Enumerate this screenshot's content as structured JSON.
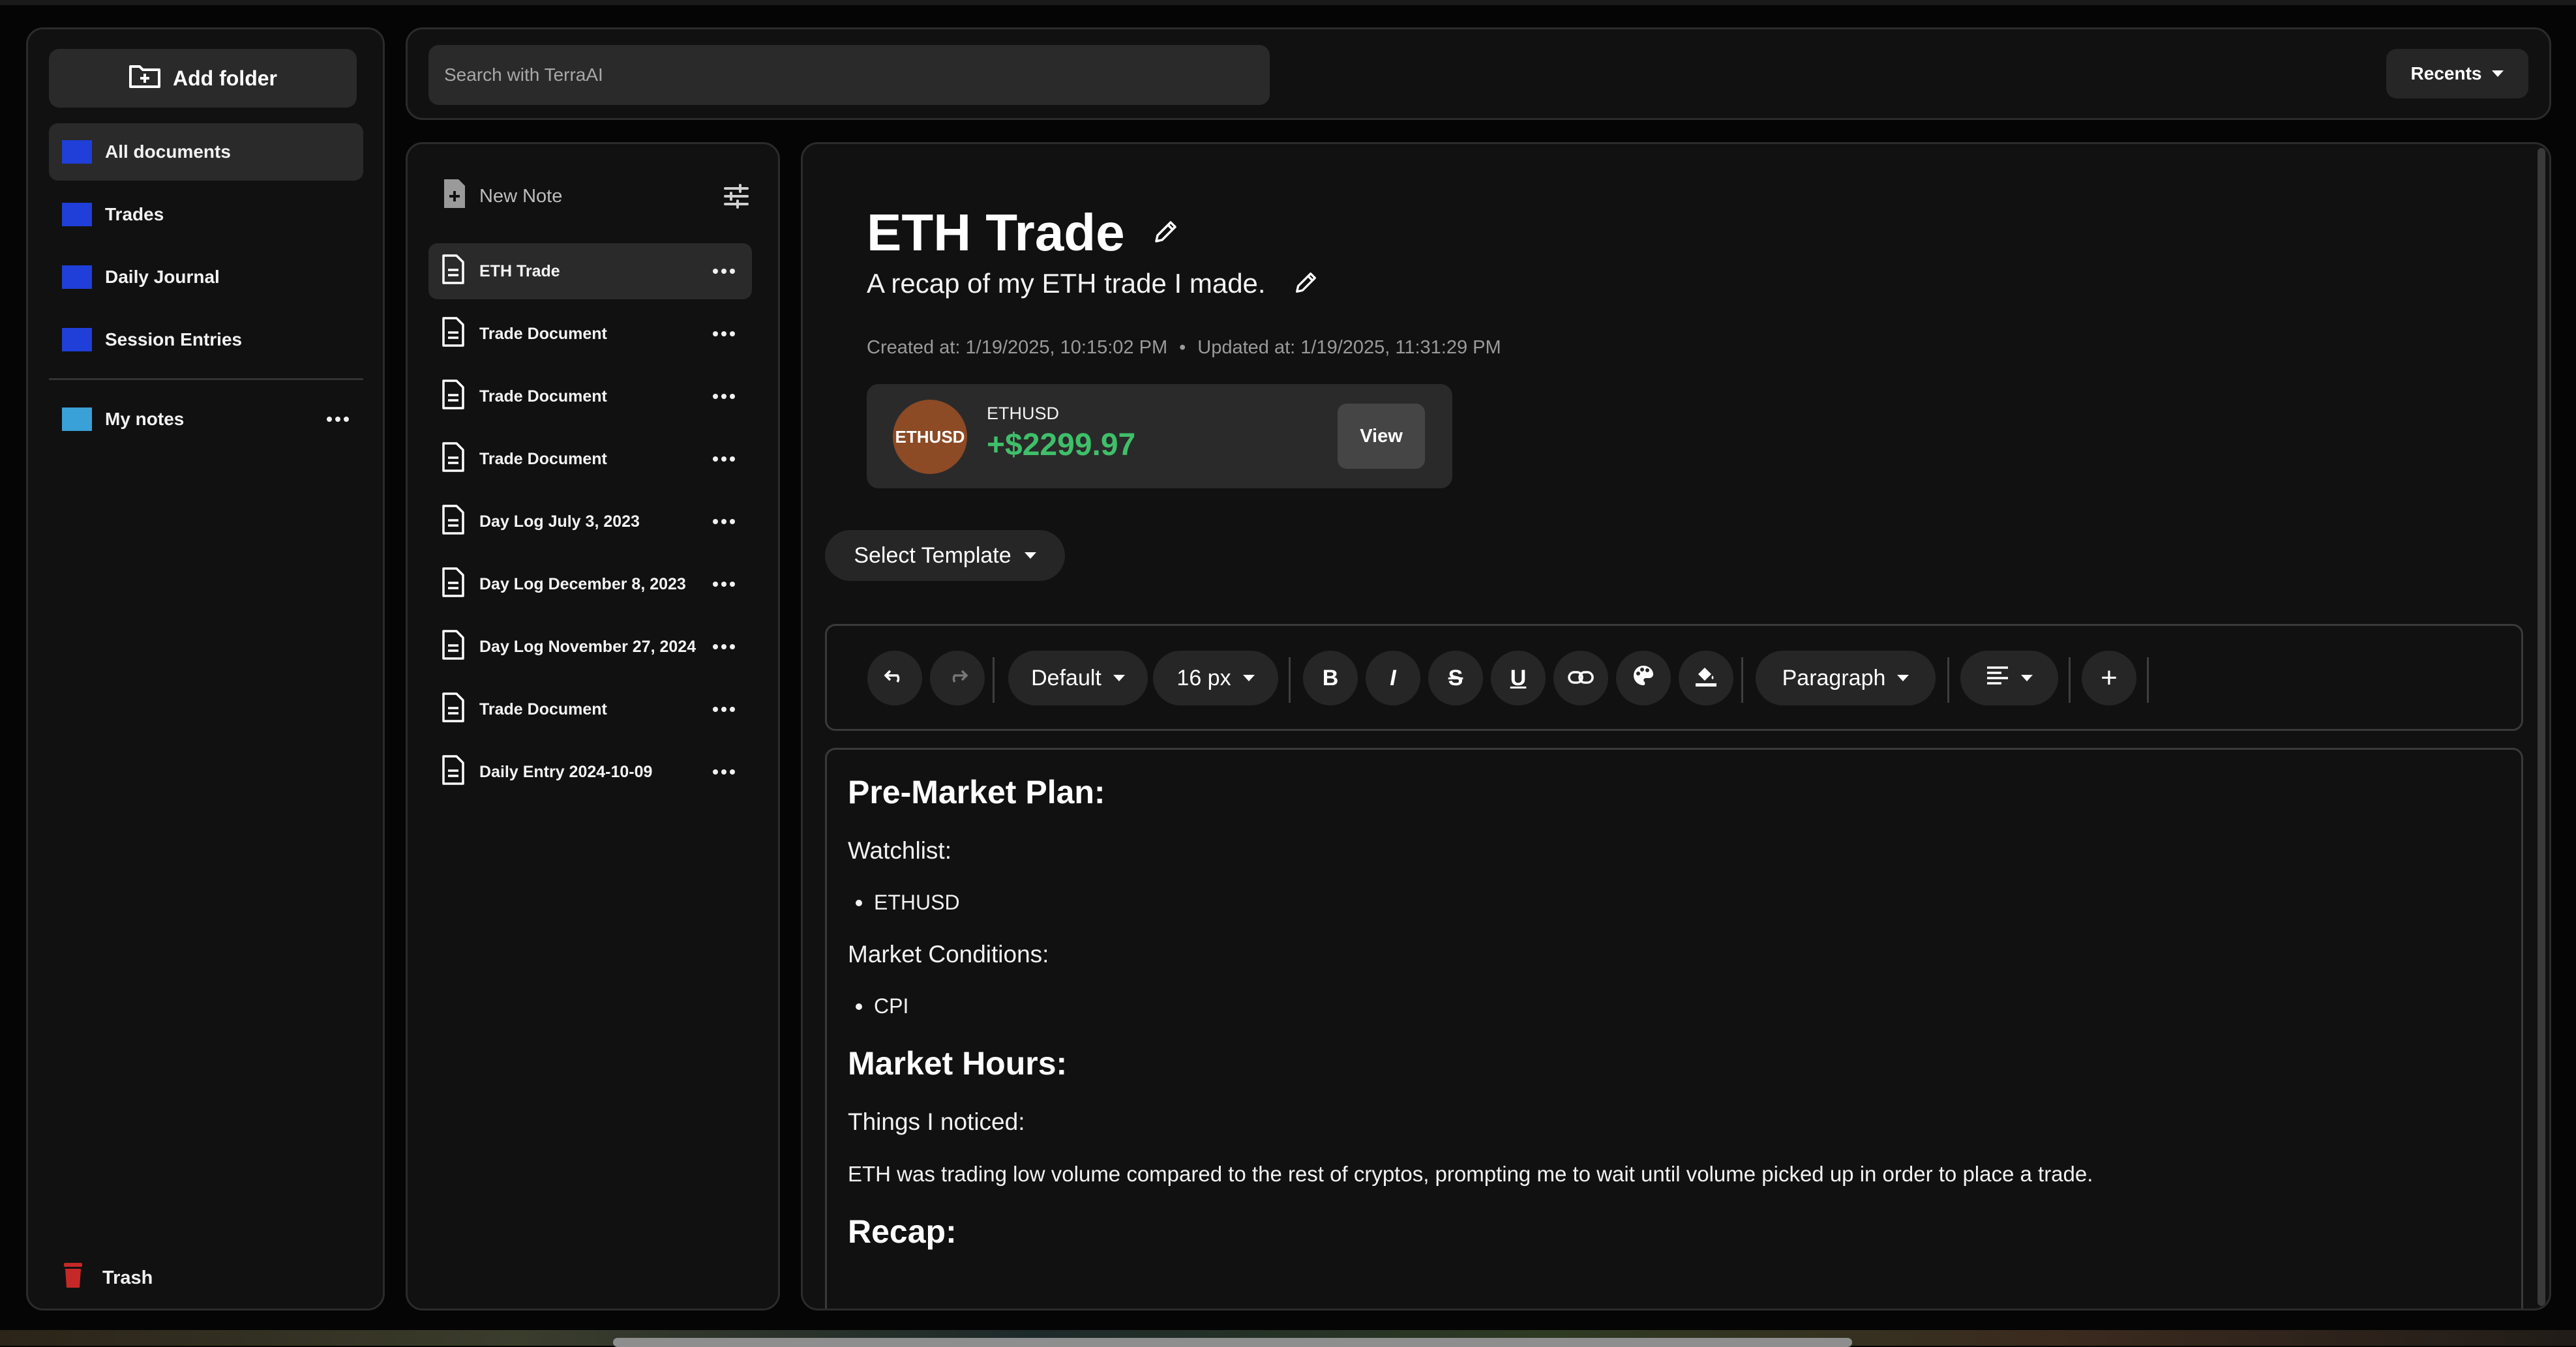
{
  "sidebar": {
    "add_folder_label": "Add folder",
    "folders": [
      {
        "label": "All documents",
        "color": "#1f3fd8"
      },
      {
        "label": "Trades",
        "color": "#1f3fd8"
      },
      {
        "label": "Daily Journal",
        "color": "#1f3fd8"
      },
      {
        "label": "Session Entries",
        "color": "#1f3fd8"
      }
    ],
    "my_notes": {
      "label": "My notes",
      "color": "#3aa0d8"
    },
    "trash_label": "Trash"
  },
  "topbar": {
    "search_placeholder": "Search with TerraAI",
    "recents_label": "Recents"
  },
  "notelist": {
    "new_note_label": "New Note",
    "notes": [
      "ETH Trade",
      "Trade Document",
      "Trade Document",
      "Trade Document",
      "Day Log July 3, 2023",
      "Day Log December 8, 2023",
      "Day Log November 27, 2024",
      "Trade Document",
      "Daily Entry 2024-10-09"
    ]
  },
  "editor": {
    "title": "ETH Trade",
    "subtitle": "A recap of my ETH trade I made.",
    "created": "Created at: 1/19/2025, 10:15:02 PM",
    "meta_sep": "•",
    "updated": "Updated at: 1/19/2025, 11:31:29 PM",
    "trade": {
      "badge": "ETHUSD",
      "symbol": "ETHUSD",
      "pnl": "+$2299.97",
      "pnl_color": "#3fbf6a",
      "view_label": "View"
    },
    "template_label": "Select Template",
    "toolbar": {
      "font": "Default",
      "size": "16 px",
      "bold": "B",
      "italic": "I",
      "strike": "S",
      "underline": "U",
      "block": "Paragraph",
      "plus": "+"
    },
    "content": {
      "h1": "Pre-Market Plan:",
      "watchlist": "Watchlist:",
      "watch_item": "ETHUSD",
      "conditions": "Market Conditions:",
      "cond_item": "CPI",
      "h2": "Market Hours:",
      "noticed": "Things I noticed:",
      "noticed_text": "ETH was trading low volume compared to the rest of cryptos, prompting me to wait until volume picked up in order to place a trade.",
      "h3": "Recap:"
    }
  }
}
